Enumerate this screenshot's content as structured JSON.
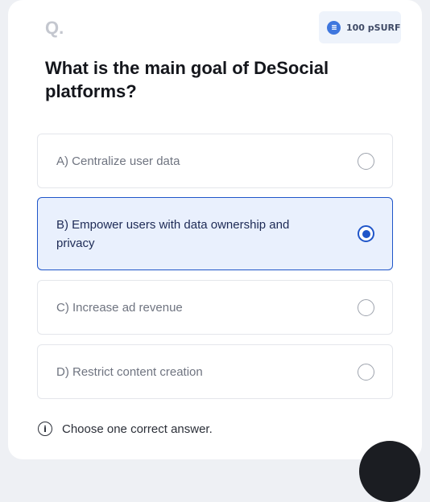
{
  "quiz": {
    "q_marker": "Q.",
    "reward_label": "100 pSURF",
    "question": "What is the main goal of DeSocial platforms?",
    "options": [
      {
        "label": "A) Centralize user data",
        "selected": false
      },
      {
        "label": "B) Empower users with data ownership and privacy",
        "selected": true
      },
      {
        "label": "C) Increase ad revenue",
        "selected": false
      },
      {
        "label": "D) Restrict content creation",
        "selected": false
      }
    ],
    "hint": "Choose one correct answer."
  },
  "icons": {
    "reward": "coin-icon",
    "info": "info-icon",
    "radio_checked": "radio-checked-icon",
    "radio_unchecked": "radio-unchecked-icon"
  },
  "colors": {
    "accent": "#1f55c9",
    "selected_bg": "#e9f0fd",
    "reward_coin": "#3f77de",
    "muted_text": "#6f7480"
  }
}
